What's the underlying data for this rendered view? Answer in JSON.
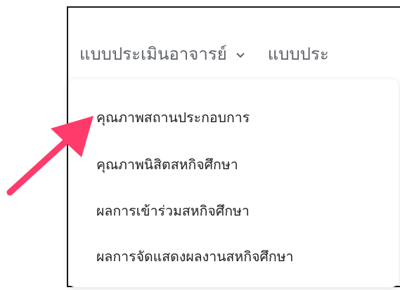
{
  "nav": {
    "items": [
      {
        "label": "แบบประเมินอาจารย์",
        "has_dropdown": true
      },
      {
        "label": "แบบประ",
        "has_dropdown": false
      }
    ]
  },
  "dropdown": {
    "items": [
      {
        "label": "คุณภาพสถานประกอบการ"
      },
      {
        "label": "คุณภาพนิสิตสหกิจศึกษา"
      },
      {
        "label": "ผลการเข้าร่วมสหกิจศึกษา"
      },
      {
        "label": "ผลการจัดแสดงผลงานสหกิจศึกษา"
      }
    ]
  },
  "annotation": {
    "arrow_color": "#ff3b6b",
    "icon": "pointer-arrow-icon"
  },
  "colors": {
    "nav_text": "#5f6368",
    "menu_text": "#1f1f1f",
    "frame_border": "#1a1a1a"
  }
}
